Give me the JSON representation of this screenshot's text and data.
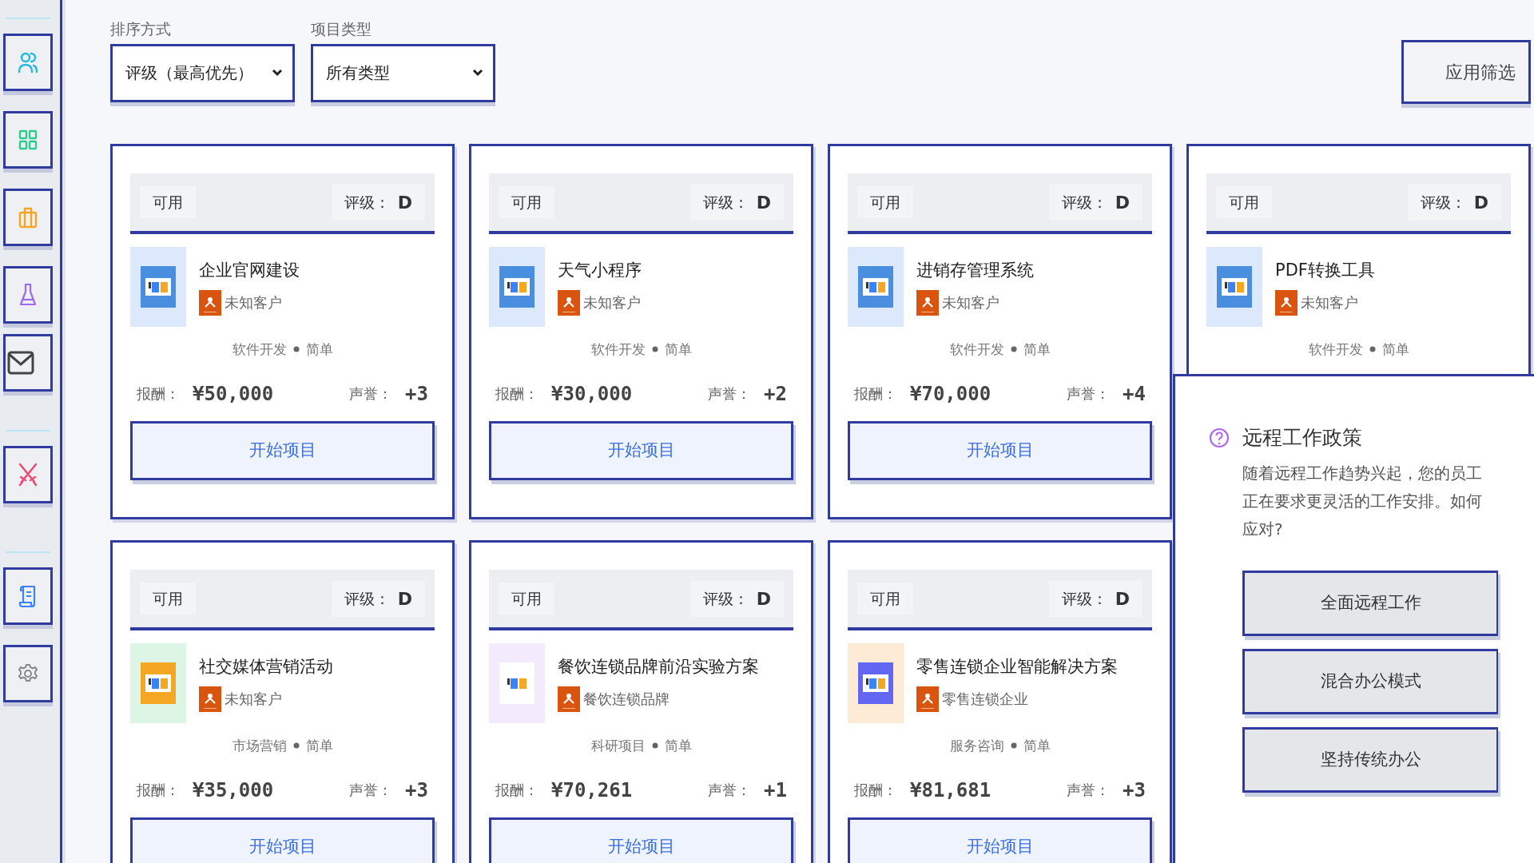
{
  "filters": {
    "sort": {
      "label": "排序方式",
      "value": "评级（最高优先）"
    },
    "type": {
      "label": "项目类型",
      "value": "所有类型"
    },
    "apply": "应用筛选"
  },
  "projects": [
    {
      "status": "可用",
      "rating_label": "评级：",
      "rating": "D",
      "title": "企业官网建设",
      "client": "未知客户",
      "category": "软件开发",
      "difficulty": "简单",
      "reward_label": "报酬：",
      "reward": "¥50,000",
      "reputation_label": "声誉：",
      "reputation": "+3",
      "button": "开始项目",
      "icon_tile": {
        "color": "#dce8fb"
      },
      "icon": {
        "color": "#4a8ee0"
      }
    },
    {
      "status": "可用",
      "rating_label": "评级：",
      "rating": "D",
      "title": "天气小程序",
      "client": "未知客户",
      "category": "软件开发",
      "difficulty": "简单",
      "reward_label": "报酬：",
      "reward": "¥30,000",
      "reputation_label": "声誉：",
      "reputation": "+2",
      "button": "开始项目",
      "icon_tile": {
        "color": "#dce8fb"
      },
      "icon": {
        "color": "#4a8ee0"
      }
    },
    {
      "status": "可用",
      "rating_label": "评级：",
      "rating": "D",
      "title": "进销存管理系统",
      "client": "未知客户",
      "category": "软件开发",
      "difficulty": "简单",
      "reward_label": "报酬：",
      "reward": "¥70,000",
      "reputation_label": "声誉：",
      "reputation": "+4",
      "button": "开始项目",
      "icon_tile": {
        "color": "#dce8fb"
      },
      "icon": {
        "color": "#4a8ee0"
      }
    },
    {
      "status": "可用",
      "rating_label": "评级：",
      "rating": "D",
      "title": "PDF转换工具",
      "client": "未知客户",
      "category": "软件开发",
      "difficulty": "简单",
      "icon_tile": {
        "color": "#dce8fb"
      },
      "icon": {
        "color": "#4a8ee0"
      }
    },
    {
      "status": "可用",
      "rating_label": "评级：",
      "rating": "D",
      "title": "社交媒体营销活动",
      "client": "未知客户",
      "category": "市场营销",
      "difficulty": "简单",
      "reward_label": "报酬：",
      "reward": "¥35,000",
      "reputation_label": "声誉：",
      "reputation": "+3",
      "button": "开始项目",
      "icon_tile": {
        "color": "#dcf5e5"
      },
      "icon": {
        "color": "#f5a623"
      }
    },
    {
      "status": "可用",
      "rating_label": "评级：",
      "rating": "D",
      "title": "餐饮连锁品牌前沿实验方案",
      "client": "餐饮连锁品牌",
      "category": "科研项目",
      "difficulty": "简单",
      "reward_label": "报酬：",
      "reward": "¥70,261",
      "reputation_label": "声誉：",
      "reputation": "+1",
      "button": "开始项目",
      "icon_tile": {
        "color": "#f3eafd"
      },
      "icon": {
        "color": "#ffffff"
      }
    },
    {
      "status": "可用",
      "rating_label": "评级：",
      "rating": "D",
      "title": "零售连锁企业智能解决方案",
      "client": "零售连锁企业",
      "category": "服务咨询",
      "difficulty": "简单",
      "reward_label": "报酬：",
      "reward": "¥81,681",
      "reputation_label": "声誉：",
      "reputation": "+3",
      "button": "开始项目",
      "icon_tile": {
        "color": "#fdebd5"
      },
      "icon": {
        "color": "#6366f1"
      }
    }
  ],
  "event": {
    "title": "远程工作政策",
    "description": "随着远程工作趋势兴起，您的员工正在要求更灵活的工作安排。如何应对?",
    "options": [
      "全面远程工作",
      "混合办公模式",
      "坚持传统办公"
    ]
  }
}
